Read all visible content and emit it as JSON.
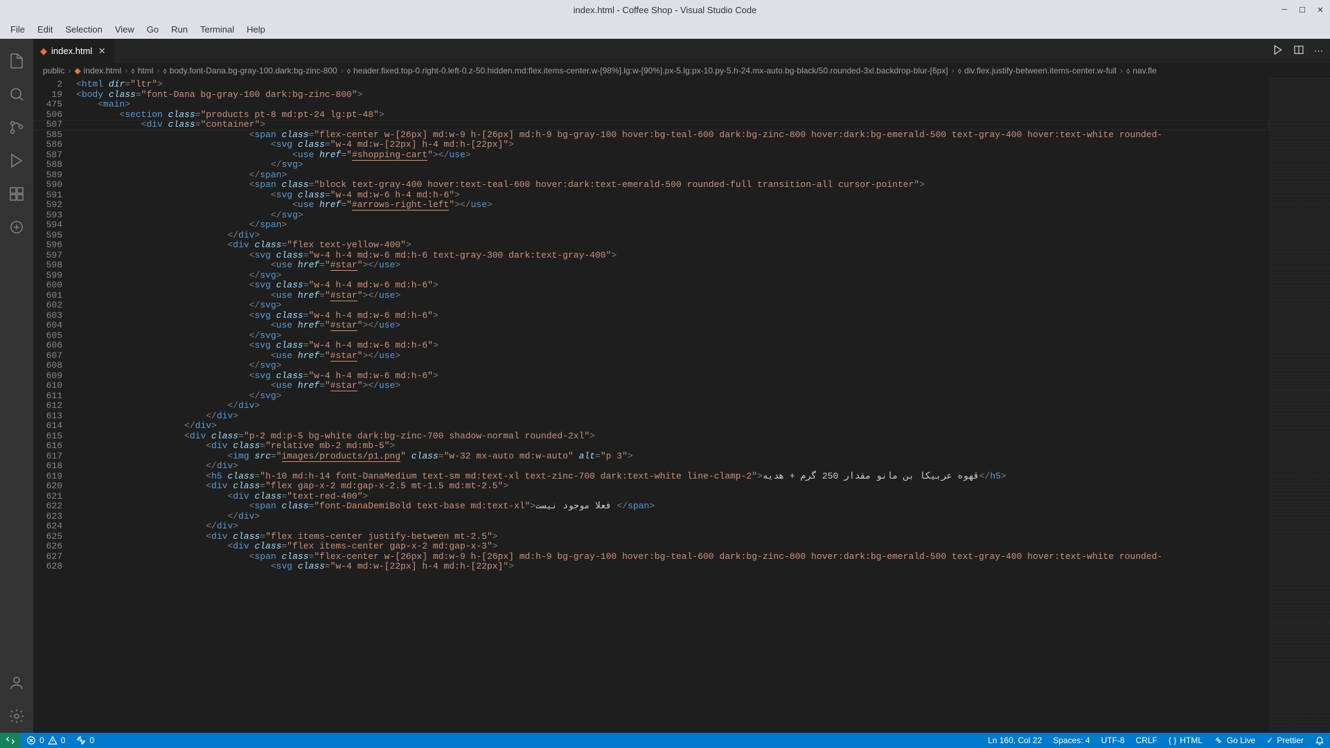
{
  "title": "index.html - Coffee Shop - Visual Studio Code",
  "menu": [
    "File",
    "Edit",
    "Selection",
    "View",
    "Go",
    "Run",
    "Terminal",
    "Help"
  ],
  "tab": {
    "label": "index.html"
  },
  "breadcrumb": {
    "p1": "public",
    "p2": "index.html",
    "p3": "html",
    "p4": "body.font-Dana.bg-gray-100.dark:bg-zinc-800",
    "p5": "header.fixed.top-0.right-0.left-0.z-50.hidden.md:flex.items-center.w-[98%].lg:w-[90%].px-5.lg:px-10.py-5.h-24.mx-auto.bg-black/50.rounded-3xl.backdrop-blur-[6px]",
    "p6": "div.flex.justify-between.items-center.w-full",
    "p7": "nav.fle"
  },
  "lineNums": [
    "2",
    "19",
    "475",
    "506",
    "507",
    "585",
    "586",
    "587",
    "588",
    "589",
    "590",
    "591",
    "592",
    "593",
    "594",
    "595",
    "596",
    "597",
    "598",
    "599",
    "600",
    "601",
    "602",
    "603",
    "604",
    "605",
    "606",
    "607",
    "608",
    "609",
    "610",
    "611",
    "612",
    "613",
    "614",
    "615",
    "616",
    "617",
    "618",
    "619",
    "620",
    "621",
    "622",
    "623",
    "624",
    "625",
    "626",
    "627",
    "628"
  ],
  "status": {
    "errors": "0",
    "warnings": "0",
    "ports": "0",
    "cursor": "Ln 160, Col 22",
    "spaces": "Spaces: 4",
    "enc": "UTF-8",
    "eol": "CRLF",
    "lang": "HTML",
    "golive": "Go Live",
    "fmt": "Prettier"
  }
}
